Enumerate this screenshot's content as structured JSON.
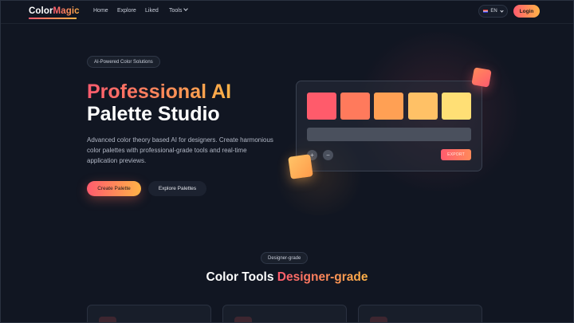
{
  "nav": {
    "logo_part1": "Color",
    "logo_part2": "Magic",
    "links": [
      "Home",
      "Explore",
      "Liked",
      "Tools"
    ],
    "language": "EN",
    "login_label": "Login"
  },
  "hero": {
    "badge": "AI-Powered Color Solutions",
    "title_line1": "Professional AI",
    "title_line2": "Palette Studio",
    "description": "Advanced color theory based AI for designers. Create harmonious color palettes with professional-grade tools and real-time application previews.",
    "primary_button": "Create Palette",
    "secondary_button": "Explore Palettes"
  },
  "palette_preview": {
    "swatches": [
      "#ff5b6b",
      "#ff7a5c",
      "#ffa054",
      "#ffc166",
      "#ffdf75"
    ],
    "plus_label": "+",
    "minus_label": "−",
    "export_label": "EXPORT"
  },
  "section": {
    "badge": "Designer-grade",
    "title_part1": "Color Tools ",
    "title_part2": "Designer-grade"
  },
  "colors": {
    "background": "#111622",
    "accent_start": "#ff5b6e",
    "accent_end": "#ffb347"
  }
}
